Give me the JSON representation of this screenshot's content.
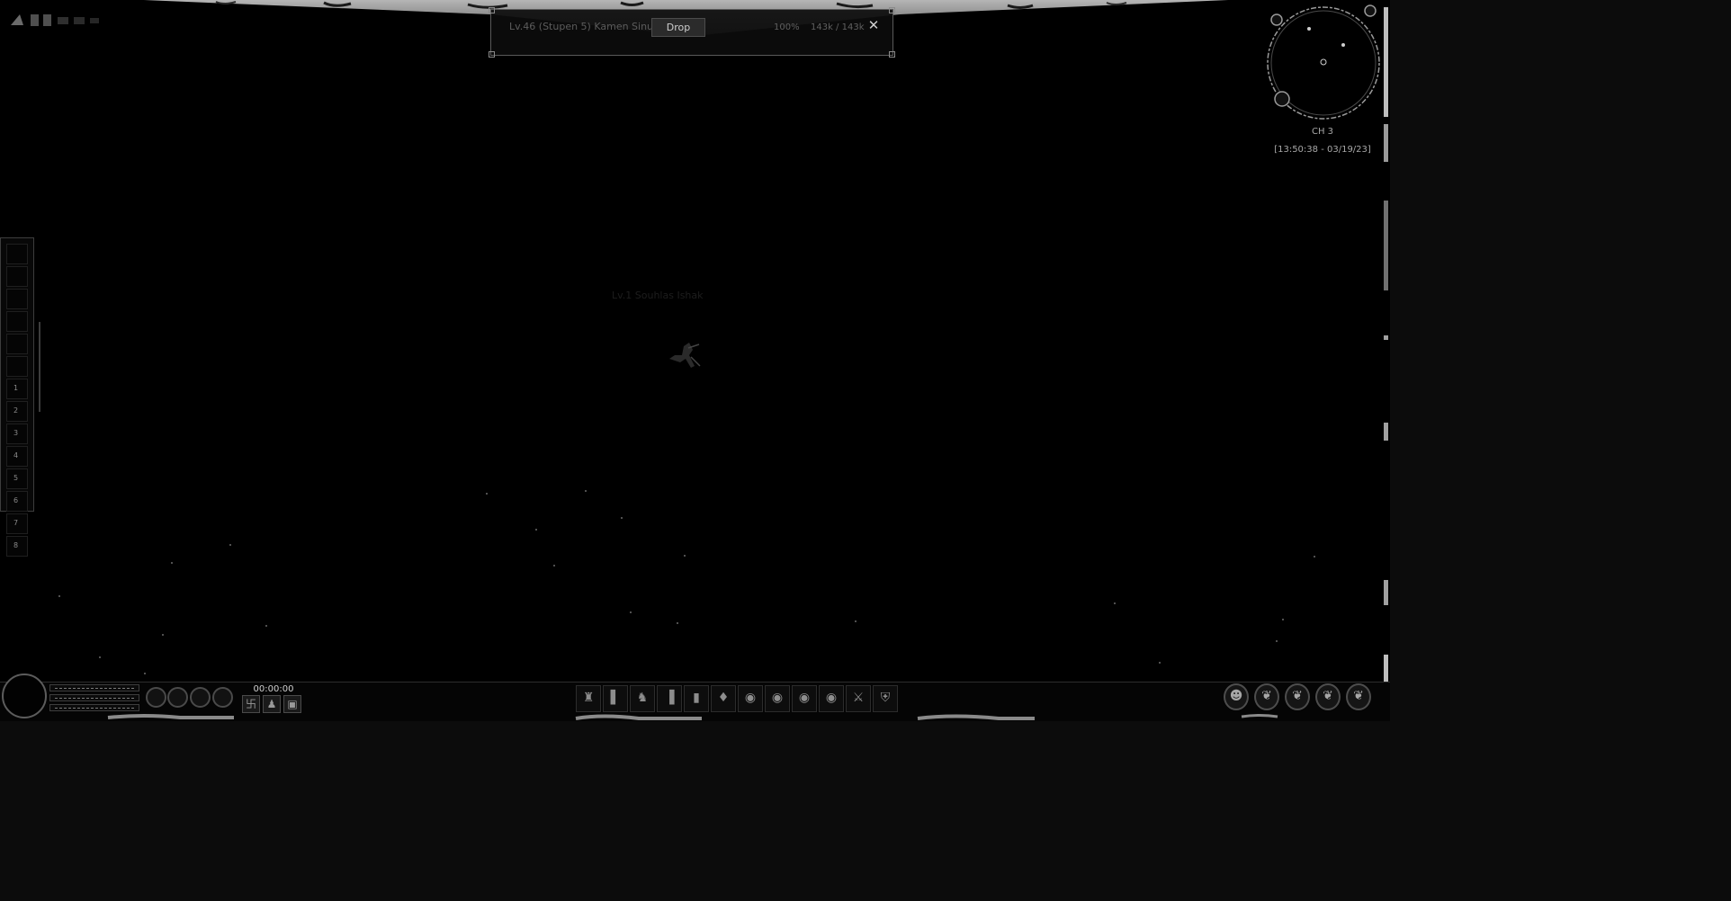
{
  "target": {
    "name": "Lv.46 (Stupen 5) Kamen Sinu",
    "drop_label": "Drop",
    "hp_percent": "100%",
    "hp_value": "143k / 143k",
    "close_icon": "close-icon"
  },
  "minimap": {
    "channel": "CH 3",
    "datetime": "[13:50:38 - 03/19/23]"
  },
  "world": {
    "location_text": "Lv.1 Souhlas Ishak"
  },
  "left_skillbar": {
    "keys": [
      "",
      "",
      "",
      "",
      "",
      "",
      "1",
      "2",
      "3",
      "4",
      "5",
      "6",
      "7",
      "8"
    ]
  },
  "status": {
    "timer": "00:00:00",
    "hp_fill": 1.0,
    "sp_fill": 1.0
  },
  "quick_buttons": [
    {
      "icon": "swirl-icon",
      "glyph": "卐"
    },
    {
      "icon": "figure-icon",
      "glyph": "♟"
    },
    {
      "icon": "box-icon",
      "glyph": "▣"
    }
  ],
  "hotkeys": [
    {
      "icon": "helmet-icon",
      "glyph": "♜"
    },
    {
      "icon": "bag-icon",
      "glyph": "▌"
    },
    {
      "icon": "figure-icon",
      "glyph": "♞"
    },
    {
      "icon": "scroll-icon",
      "glyph": "▐"
    },
    {
      "icon": "card-icon",
      "glyph": "▮"
    },
    {
      "icon": "gem-icon",
      "glyph": "♦"
    },
    {
      "icon": "orb-icon",
      "glyph": "◉"
    },
    {
      "icon": "orb-icon",
      "glyph": "◉"
    },
    {
      "icon": "orb-icon",
      "glyph": "◉"
    },
    {
      "icon": "orb-icon",
      "glyph": "◉"
    },
    {
      "icon": "sword-icon",
      "glyph": "⚔"
    },
    {
      "icon": "shield-icon",
      "glyph": "⛨"
    }
  ],
  "menu_buttons": [
    {
      "icon": "character-icon",
      "glyph": "☻"
    },
    {
      "icon": "dragon-icon",
      "glyph": "❦"
    },
    {
      "icon": "dragon-icon",
      "glyph": "❦"
    },
    {
      "icon": "dragon-icon",
      "glyph": "❦"
    },
    {
      "icon": "dragon-icon",
      "glyph": "❦"
    }
  ]
}
